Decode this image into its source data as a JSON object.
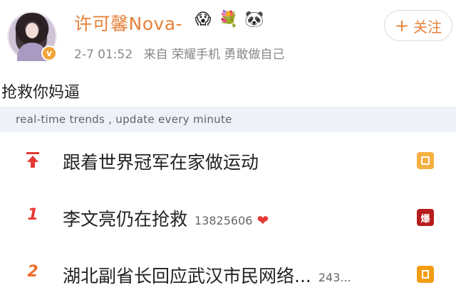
{
  "user": {
    "name": "许可馨Nova-",
    "verified_badge": "v",
    "emojis": [
      "😱",
      "💐",
      "🐼"
    ]
  },
  "meta": {
    "time": "2-7 01:52",
    "source": "来自 荣耀手机 勇敢做自己"
  },
  "follow_button": {
    "plus": "+",
    "label": "关注"
  },
  "post": {
    "text": "抢救你妈逼"
  },
  "trend_header": {
    "text": "real-time trends , update every minute"
  },
  "trends": [
    {
      "rank": "",
      "topic": "跟着世界冠军在家做运动",
      "count": "",
      "tag": "",
      "tag_color": "#f5b041",
      "pinned": true
    },
    {
      "rank": "1",
      "topic": "李文亮仍在抢救",
      "count": "13825606",
      "tag": "爆",
      "tag_color": "#b71c1c",
      "heart": "❤"
    },
    {
      "rank": "2",
      "topic": "湖北副省长回应武汉市民网络...",
      "count": "243...",
      "tag": "",
      "tag_color": "#f39c12"
    }
  ],
  "colors": {
    "accent": "#e7813a",
    "rank_red": "#e53935",
    "rank_orange": "#ef6c2e"
  }
}
